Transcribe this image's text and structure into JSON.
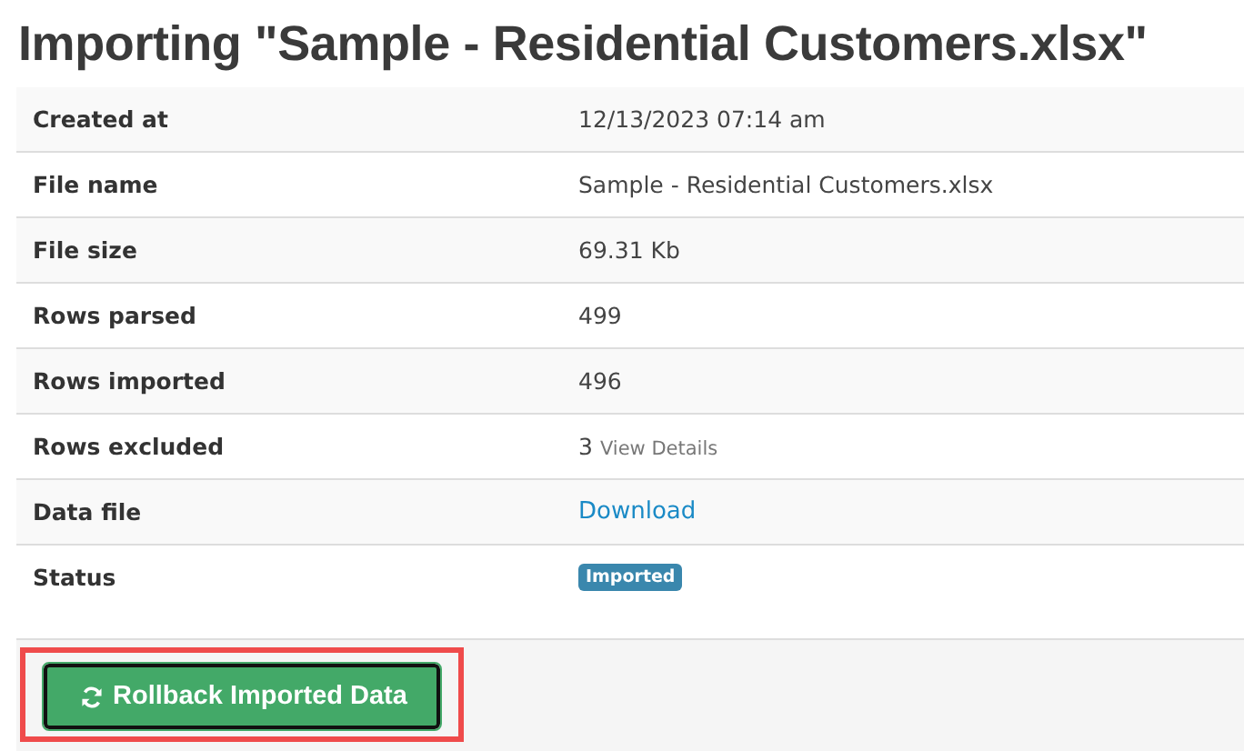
{
  "title": "Importing \"Sample - Residential Customers.xlsx\"",
  "rows": [
    {
      "label": "Created at",
      "kind": "text",
      "value": "12/13/2023 07:14 am"
    },
    {
      "label": "File name",
      "kind": "text",
      "value": "Sample - Residential Customers.xlsx"
    },
    {
      "label": "File size",
      "kind": "text",
      "value": "69.31 Kb"
    },
    {
      "label": "Rows parsed",
      "kind": "text",
      "value": "499"
    },
    {
      "label": "Rows imported",
      "kind": "text",
      "value": "496"
    },
    {
      "label": "Rows excluded",
      "kind": "count_link",
      "value": "3",
      "link": "View Details"
    },
    {
      "label": "Data file",
      "kind": "link",
      "value": "Download"
    },
    {
      "label": "Status",
      "kind": "badge",
      "value": "Imported"
    }
  ],
  "action_button": {
    "label": "Rollback Imported Data"
  }
}
